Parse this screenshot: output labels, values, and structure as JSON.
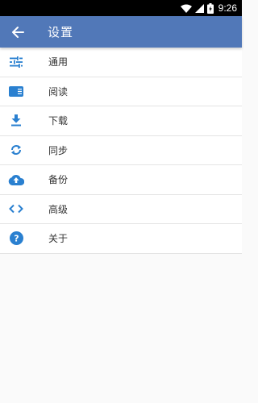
{
  "status_bar": {
    "time": "9:26",
    "icons": [
      "wifi-icon",
      "signal-icon",
      "battery-icon"
    ]
  },
  "header": {
    "title": "设置",
    "back_icon": "arrow-left-icon",
    "background": "#5178b8"
  },
  "accent_color": "#2a80d0",
  "menu": [
    {
      "label": "通用",
      "icon": "tune-sliders-icon"
    },
    {
      "label": "阅读",
      "icon": "reading-icon"
    },
    {
      "label": "下载",
      "icon": "download-icon"
    },
    {
      "label": "同步",
      "icon": "sync-icon"
    },
    {
      "label": "备份",
      "icon": "cloud-upload-icon"
    },
    {
      "label": "高级",
      "icon": "code-brackets-icon"
    },
    {
      "label": "关于",
      "icon": "help-icon"
    }
  ]
}
